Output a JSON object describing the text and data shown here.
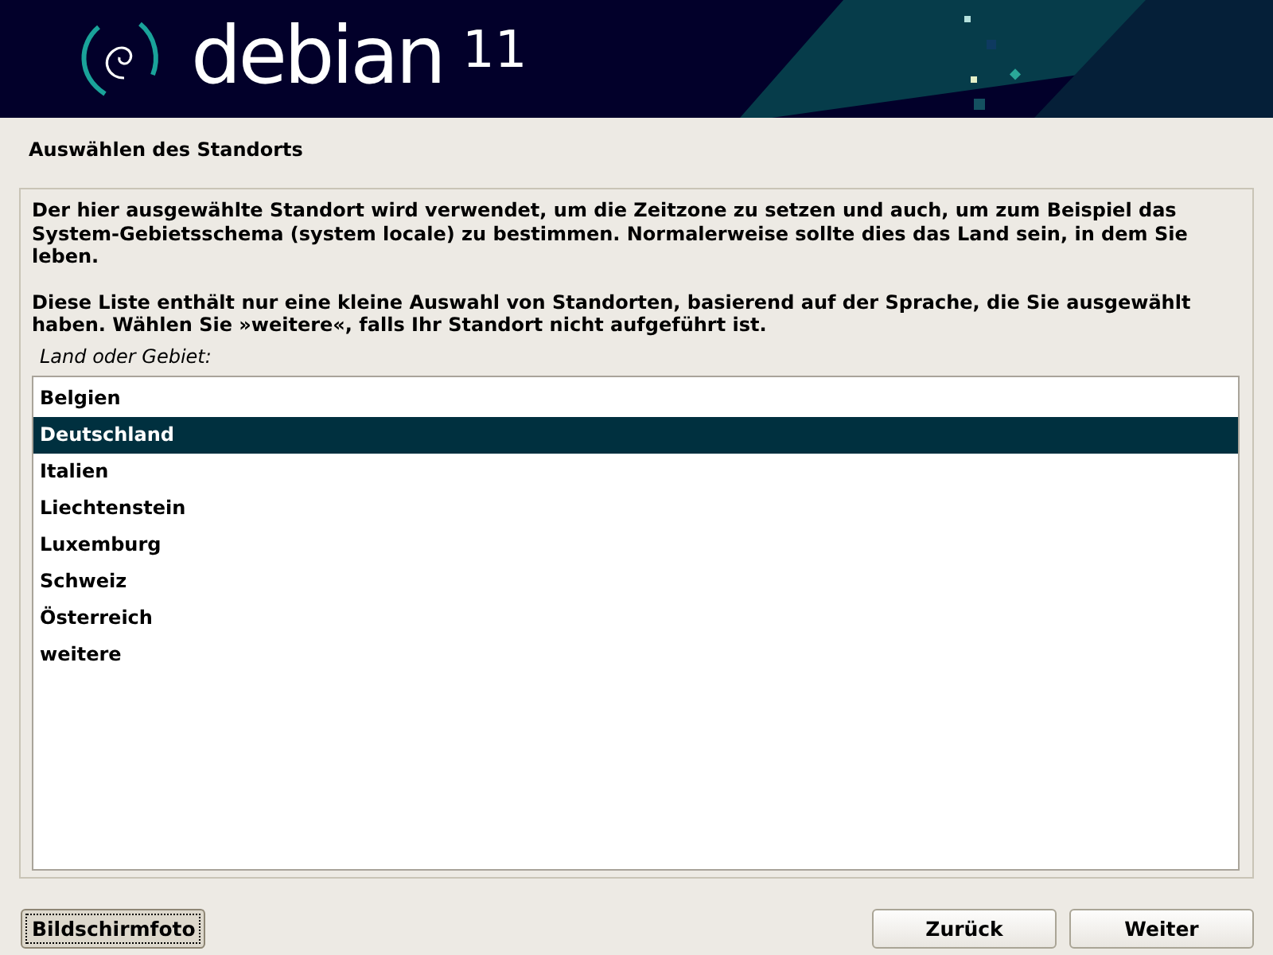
{
  "banner": {
    "logo_text": "debian",
    "version": "11"
  },
  "title": "Auswählen des Standorts",
  "paragraphs": [
    "Der hier ausgewählte Standort wird verwendet, um die Zeitzone zu setzen und auch, um zum Beispiel das System-Gebietsschema (system locale) zu bestimmen. Normalerweise sollte dies das Land sein, in dem Sie leben.",
    "Diese Liste enthält nur eine kleine Auswahl von Standorten, basierend auf der Sprache, die Sie ausgewählt haben. Wählen Sie »weitere«, falls Ihr Standort nicht aufgeführt ist."
  ],
  "list_label": "Land oder Gebiet:",
  "items": [
    {
      "label": "Belgien",
      "selected": false
    },
    {
      "label": "Deutschland",
      "selected": true
    },
    {
      "label": "Italien",
      "selected": false
    },
    {
      "label": "Liechtenstein",
      "selected": false
    },
    {
      "label": "Luxemburg",
      "selected": false
    },
    {
      "label": "Schweiz",
      "selected": false
    },
    {
      "label": "Österreich",
      "selected": false
    },
    {
      "label": "weitere",
      "selected": false
    }
  ],
  "buttons": [
    {
      "label": "Bildschirmfoto",
      "focused": true
    },
    {
      "label": "Zurück",
      "focused": false
    },
    {
      "label": "Weiter",
      "focused": false
    }
  ]
}
